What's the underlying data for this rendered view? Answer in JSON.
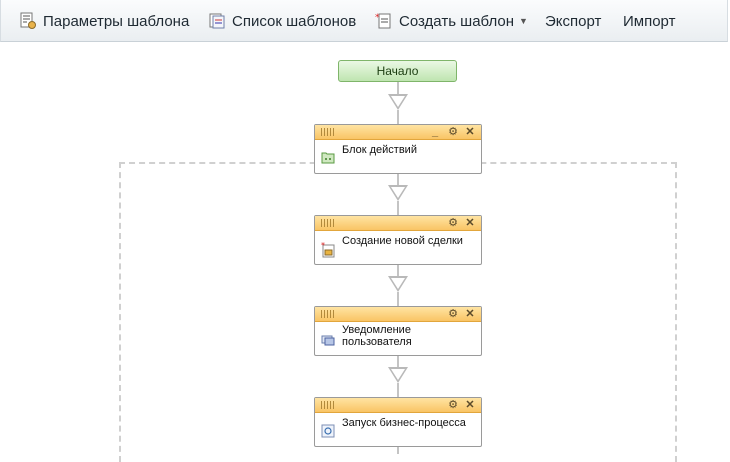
{
  "toolbar": {
    "template_params": "Параметры шаблона",
    "template_list": "Список шаблонов",
    "create_template": "Создать шаблон",
    "export": "Экспорт",
    "import": "Импорт"
  },
  "flow": {
    "start_label": "Начало",
    "blocks": [
      {
        "title": "Блок действий",
        "icon": "action-block-icon"
      },
      {
        "title": "Создание новой сделки",
        "icon": "new-deal-icon"
      },
      {
        "title_line1": "Уведомление",
        "title_line2": "пользователя",
        "icon": "notify-user-icon"
      },
      {
        "title": "Запуск бизнес-процесса",
        "icon": "start-bp-icon"
      }
    ]
  },
  "colors": {
    "header_top": "#ffe4a3",
    "header_bottom": "#f9c465",
    "start_fill": "#bfe5b0"
  }
}
